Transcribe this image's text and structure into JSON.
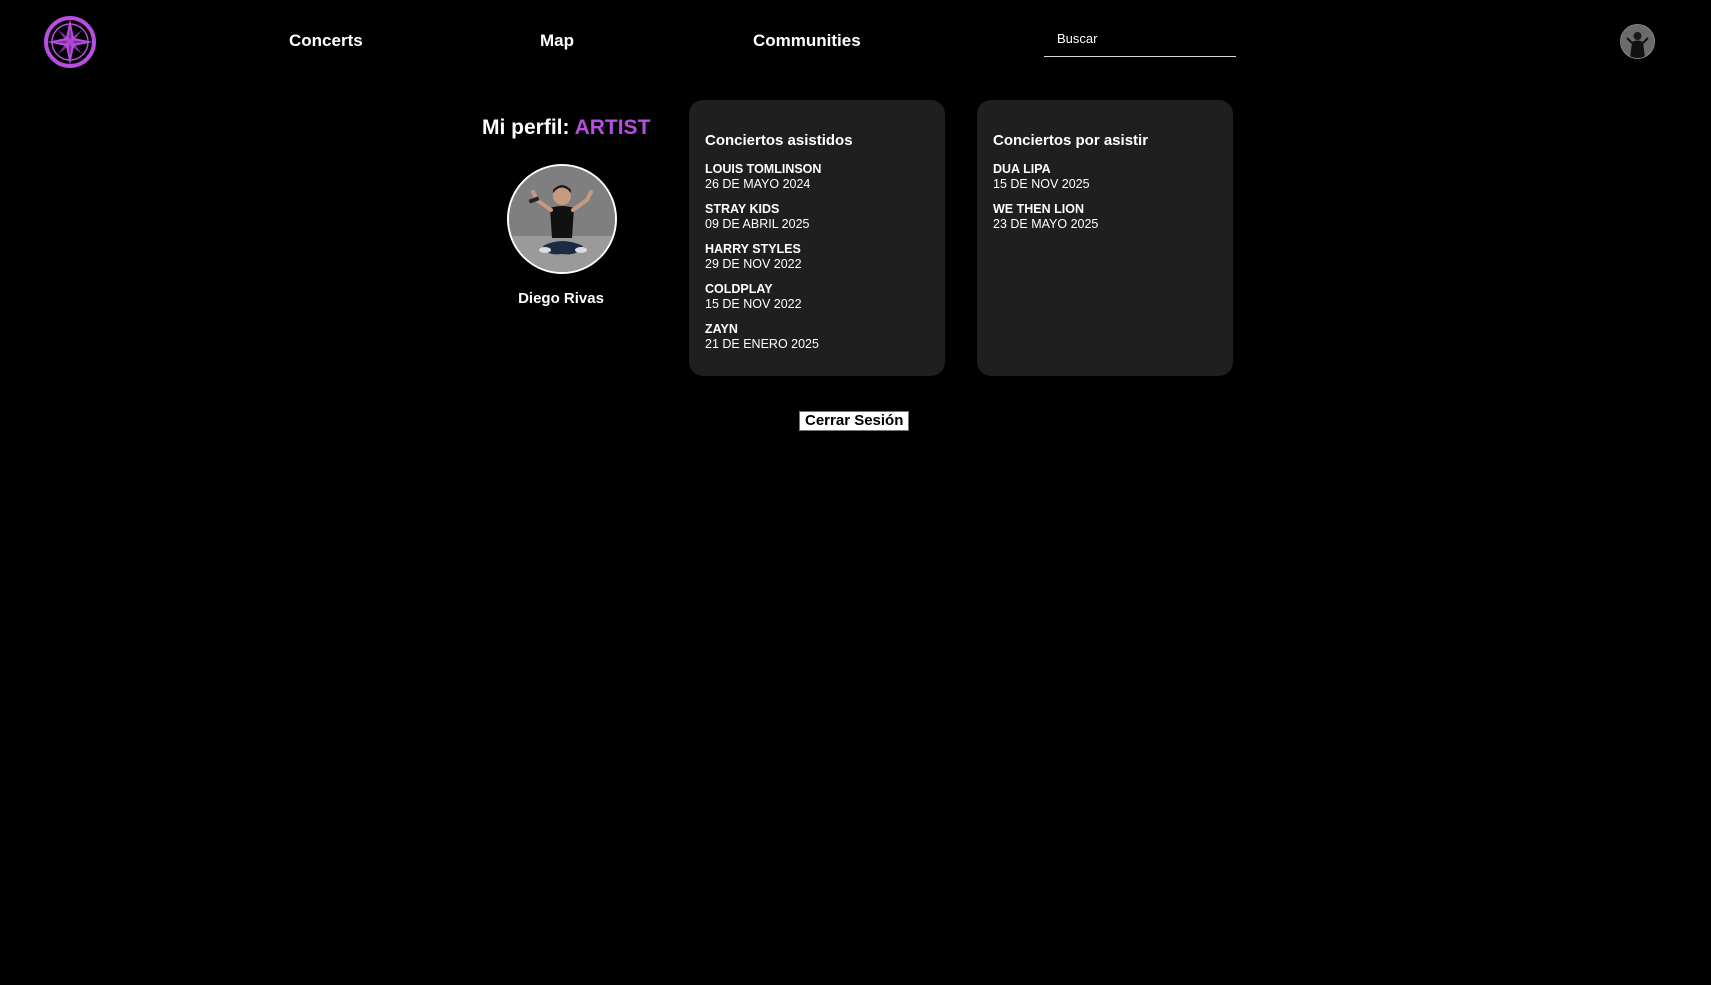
{
  "nav": {
    "concerts": "Concerts",
    "map": "Map",
    "communities": "Communities"
  },
  "search": {
    "placeholder": "Buscar",
    "value": ""
  },
  "icons": {
    "logo": "compass-star-logo",
    "header_avatar": "user-avatar",
    "profile_photo": "profile-photo"
  },
  "colors": {
    "accent": "#b84ee0",
    "background": "#000000",
    "card": "#1f1f1f"
  },
  "profile": {
    "title_prefix": "Mi perfil:",
    "role": "ARTIST",
    "name": "Diego Rivas"
  },
  "attended": {
    "title": "Conciertos asistidos",
    "items": [
      {
        "artist": "LOUIS TOMLINSON",
        "date": "26 DE MAYO 2024"
      },
      {
        "artist": "STRAY KIDS",
        "date": "09 DE ABRIL 2025"
      },
      {
        "artist": "HARRY STYLES",
        "date": "29 DE NOV 2022"
      },
      {
        "artist": "COLDPLAY",
        "date": "15 DE NOV 2022"
      },
      {
        "artist": "ZAYN",
        "date": "21 DE ENERO 2025"
      }
    ]
  },
  "upcoming": {
    "title": "Conciertos por asistir",
    "items": [
      {
        "artist": "DUA LIPA",
        "date": "15 DE NOV 2025"
      },
      {
        "artist": "WE THEN LION",
        "date": "23 DE MAYO 2025"
      }
    ]
  },
  "logout": {
    "label": "Cerrar Sesión"
  }
}
